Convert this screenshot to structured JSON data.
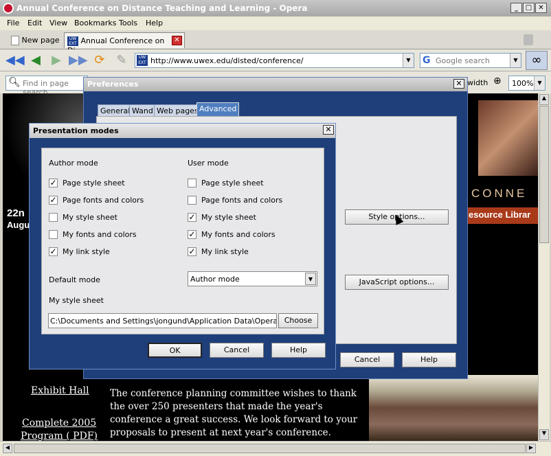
{
  "window": {
    "title": "Annual Conference on Distance Teaching and Learning - Opera"
  },
  "menu": [
    "File",
    "Edit",
    "View",
    "Bookmarks",
    "Tools",
    "Help"
  ],
  "tabs": {
    "new_page": "New page",
    "active_tab": "Annual Conference on Di..."
  },
  "address": {
    "url": "http://www.uwex.edu/disted/conference/",
    "site_badge": "UW EXT"
  },
  "search": {
    "placeholder": "Google search"
  },
  "findbar": {
    "find_placeholder": "Find in page search",
    "width_label": "width",
    "zoom": "100%"
  },
  "webpage": {
    "left_date": "22n",
    "left_date2": "Augu",
    "connect_banner": "CONNE",
    "resource_link": "esource Librar",
    "exhibit_link": "Exhibit Hall",
    "program_link1": "Complete 2005",
    "program_link2": "Program ( PDF)",
    "message": "The conference planning committee wishes to thank the over 250 presenters that made the year's conference a great success. We look forward to your proposals to present at next year's conference."
  },
  "preferences": {
    "title": "Preferences",
    "tabs": [
      "General",
      "Wand",
      "Web pages",
      "Advanced"
    ],
    "active_tab": "Advanced",
    "style_options": "Style options...",
    "javascript_options": "JavaScript options...",
    "cancel": "Cancel",
    "help": "Help"
  },
  "presentation_modes": {
    "title": "Presentation modes",
    "author_mode_header": "Author mode",
    "user_mode_header": "User mode",
    "author_items": [
      {
        "label": "Page style sheet",
        "checked": true
      },
      {
        "label": "Page fonts and colors",
        "checked": true
      },
      {
        "label": "My style sheet",
        "checked": false
      },
      {
        "label": "My fonts and colors",
        "checked": false
      },
      {
        "label": "My link style",
        "checked": true
      }
    ],
    "user_items": [
      {
        "label": "Page style sheet",
        "checked": false
      },
      {
        "label": "Page fonts and colors",
        "checked": false
      },
      {
        "label": "My style sheet",
        "checked": true
      },
      {
        "label": "My fonts and colors",
        "checked": true
      },
      {
        "label": "My link style",
        "checked": true
      }
    ],
    "default_mode_label": "Default mode",
    "default_mode_value": "Author mode",
    "my_style_sheet_label": "My style sheet",
    "style_sheet_path": "C:\\Documents and Settings\\jongund\\Application Data\\Opera\\Opera\\",
    "choose": "Choose",
    "ok": "OK",
    "cancel": "Cancel",
    "help": "Help"
  }
}
